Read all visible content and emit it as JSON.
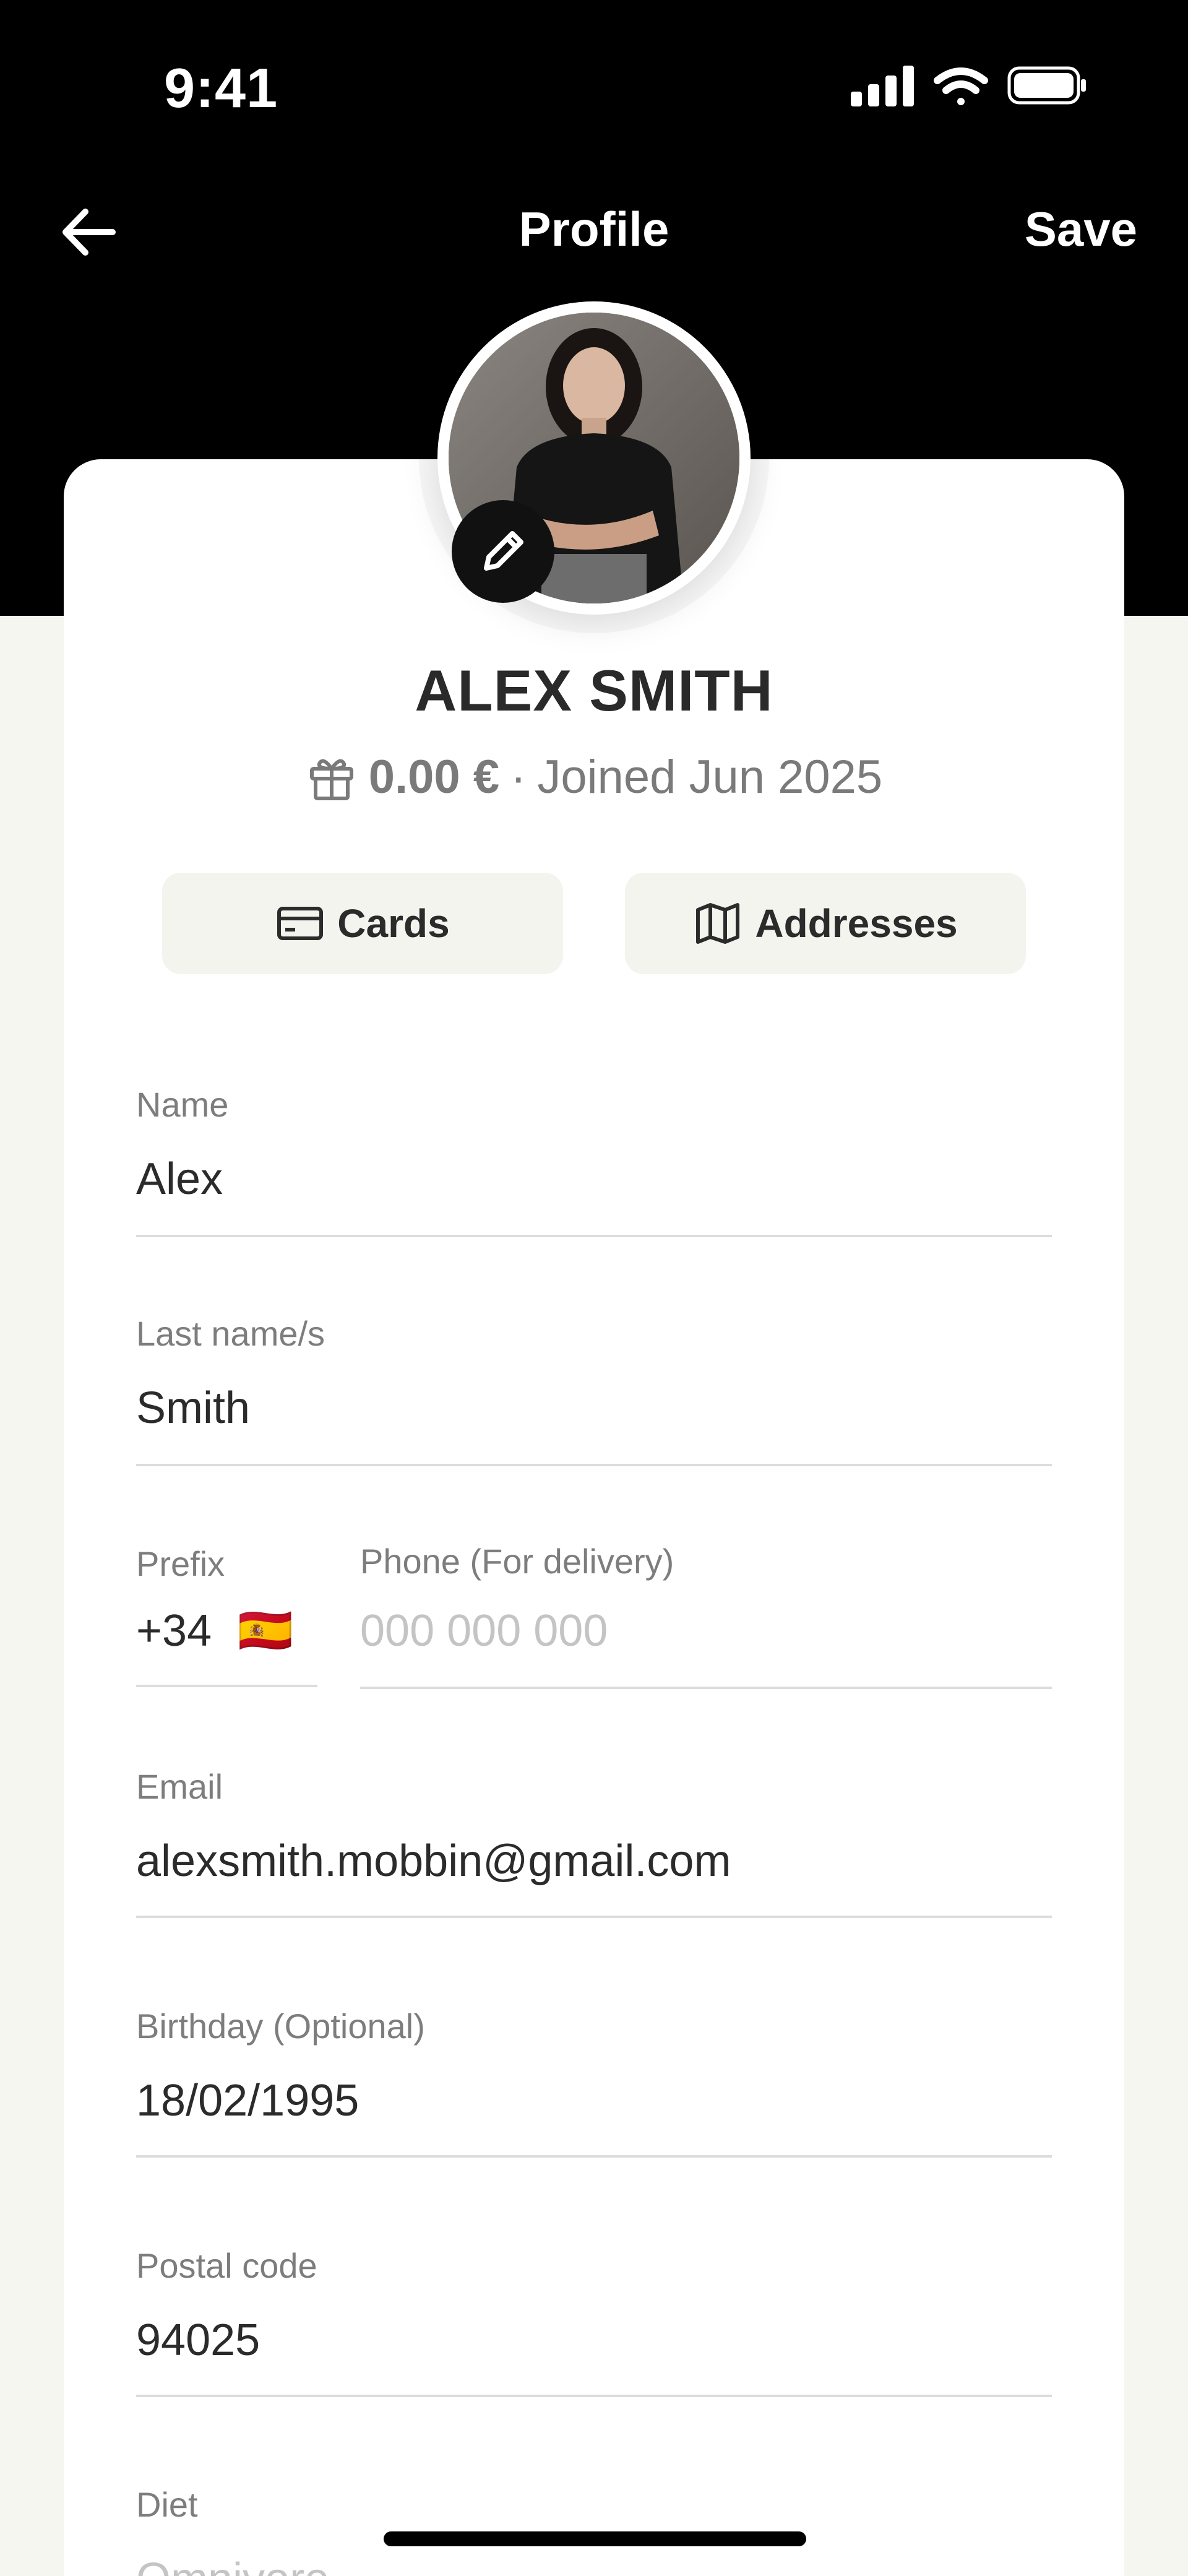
{
  "status_bar": {
    "time": "9:41"
  },
  "nav": {
    "title": "Profile",
    "save_label": "Save"
  },
  "profile": {
    "name": "ALEX SMITH",
    "balance": "0.00 €",
    "separator": "·",
    "joined": "Joined Jun 2025"
  },
  "actions": {
    "cards_label": "Cards",
    "addresses_label": "Addresses"
  },
  "form": {
    "name": {
      "label": "Name",
      "value": "Alex"
    },
    "last_name": {
      "label": "Last name/s",
      "value": "Smith"
    },
    "prefix": {
      "label": "Prefix",
      "value": "+34",
      "flag": "🇪🇸"
    },
    "phone": {
      "label": "Phone (For delivery)",
      "placeholder": "000 000 000"
    },
    "email": {
      "label": "Email",
      "value": "alexsmith.mobbin@gmail.com"
    },
    "birthday": {
      "label": "Birthday (Optional)",
      "value": "18/02/1995"
    },
    "postal_code": {
      "label": "Postal code",
      "value": "94025"
    },
    "diet": {
      "label": "Diet",
      "placeholder": "Omnivore"
    }
  },
  "colors": {
    "header_bg": "#000000",
    "page_bg": "#f6f6f1",
    "card_bg": "#ffffff",
    "pill_bg": "#f4f4ef",
    "label": "#7d7d7d",
    "text": "#2b2b2b"
  },
  "icons": {
    "back": "arrow-left-icon",
    "edit": "pencil-icon",
    "gift": "gift-icon",
    "card": "credit-card-icon",
    "map": "map-icon",
    "signal": "signal-icon",
    "wifi": "wifi-icon",
    "battery": "battery-icon"
  }
}
